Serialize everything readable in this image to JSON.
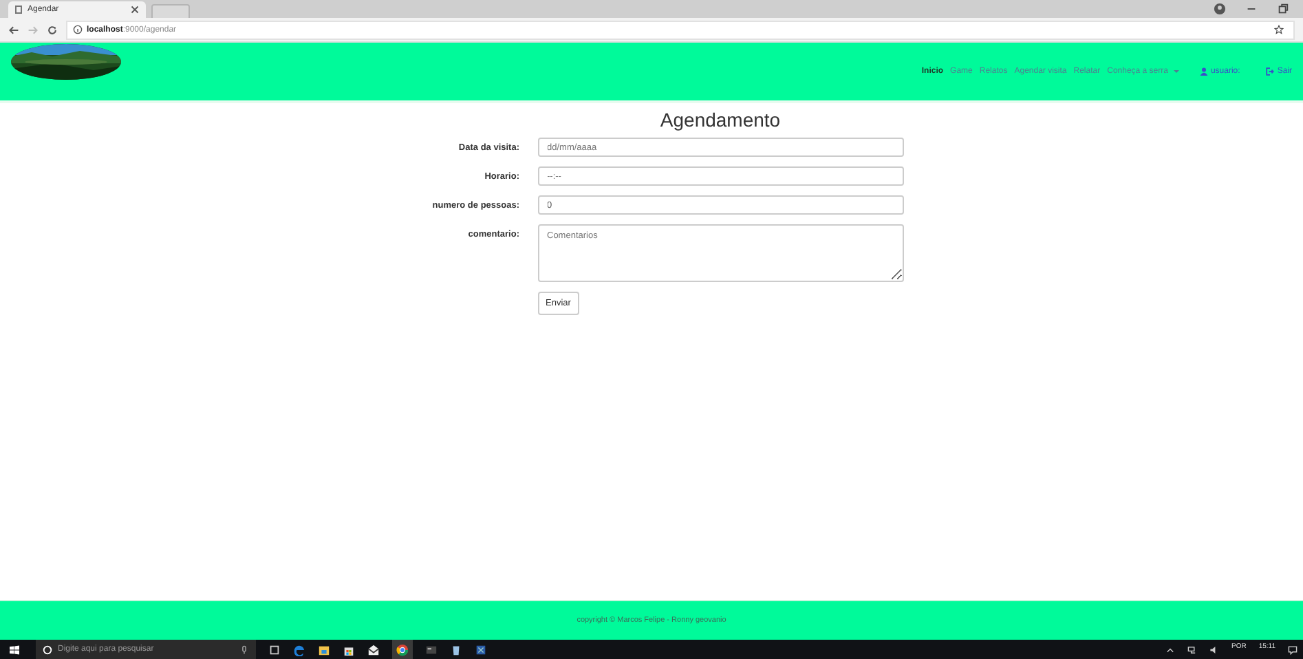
{
  "browser": {
    "tab_title": "Agendar",
    "url_host": "localhost",
    "url_path": ":9000/agendar"
  },
  "nav": {
    "items": [
      {
        "label": "Inicio",
        "selected": true
      },
      {
        "label": "Game",
        "selected": false
      },
      {
        "label": "Relatos",
        "selected": false
      },
      {
        "label": "Agendar visita",
        "selected": false
      },
      {
        "label": "Relatar",
        "selected": false
      },
      {
        "label": "Conheça a serra",
        "selected": false,
        "dropdown": true
      }
    ],
    "user": "usuario:",
    "logout": "Sair"
  },
  "form": {
    "title": "Agendamento",
    "fields": [
      {
        "label": "Data da visita:",
        "kind": "input",
        "placeholder": "dd/mm/aaaa"
      },
      {
        "label": "Horario:",
        "kind": "input",
        "placeholder": "--:--"
      },
      {
        "label": "numero de pessoas:",
        "kind": "input",
        "value": "0"
      },
      {
        "label": "comentario:",
        "kind": "textarea",
        "placeholder": "Comentarios"
      }
    ],
    "submit": "Enviar"
  },
  "footer": "copyright © Marcos Felipe - Ronny geovanio",
  "taskbar": {
    "search_placeholder": "Digite aqui para pesquisar",
    "language": "POR",
    "time": "15:11"
  }
}
